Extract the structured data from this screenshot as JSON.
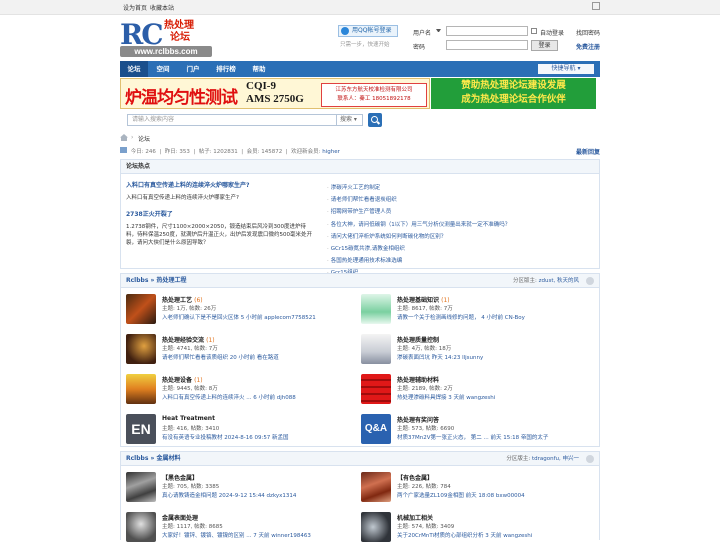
{
  "topbar": {
    "set_home": "设为首页",
    "bookmark": "收藏本站"
  },
  "logo": {
    "rc": "RC",
    "cn_line1": "热处理",
    "cn_line2": "论坛",
    "url": "www.rclbbs.com"
  },
  "login": {
    "qq_button": "用QQ帐号登录",
    "qq_sub": "只需一步，快速开始",
    "username_label": "用户名",
    "password_label": "密码",
    "auto_login": "自动登录",
    "forgot": "找回密码",
    "login_button": "登录",
    "register": "免费注册"
  },
  "nav": {
    "items": [
      "论坛",
      "空间",
      "门户",
      "排行榜",
      "帮助"
    ],
    "quick": "快捷导航"
  },
  "banner1": {
    "headline": "炉温均匀性测试",
    "model1": "CQI-9",
    "model2": "AMS 2750G",
    "company": "江苏东方航天校准检测有限公司",
    "contact": "联系人：秦工 18051892178"
  },
  "banner2": {
    "line1": "赞助热处理论坛建设发展",
    "line2": "成为热处理论坛合作伙伴"
  },
  "search": {
    "placeholder": "请输入搜索内容",
    "select": "搜索"
  },
  "breadcrumb": {
    "current": "论坛"
  },
  "stats": {
    "today_label": "今日:",
    "today": "246",
    "yesterday_label": "昨日:",
    "yesterday": "353",
    "posts_label": "帖子:",
    "posts": "1202831",
    "members_label": "会员:",
    "members": "145872",
    "newest_label": "欢迎新会员:",
    "newest": "higher",
    "latest_reply": "最新回复"
  },
  "hot": {
    "title": "论坛热点",
    "left": [
      {
        "title": "入料口有真空传递上料的连续淬火炉哪家生产?",
        "body": "入料口有真空传递上料的连续淬火炉哪家生产?"
      },
      {
        "title": "2738正火开裂了",
        "body": "1.2738钢件，尺寸1100×2000×2050，锻造结束后风冷到300度进炉待料，待料保温250度，就满炉后升温正火，出炉后发现震口微约500毫米处开裂，请问大侠们是什么原因导致？"
      }
    ],
    "right": [
      "渗碳淬火工艺的制定",
      "请老师们帮忙看看退炭组织",
      "招聘网带炉生产管理人员",
      "各位大神，请问低碳钢（1以下）用三气分析仪测量出来就一定不准确吗？",
      "请问大佬们淬析炉系统如何判断碳化物的区别？",
      "GCr15碳氮共渗,请教金相组织",
      "各国热处理通用技术标准选编",
      "Gcr15组织"
    ]
  },
  "sections": [
    {
      "cat": "Rclbbs » 热处理工程",
      "moderators_label": "分区版主:",
      "moderators": "zdust, 秋天的风",
      "forums": [
        {
          "name": "热处理工艺",
          "today": "(6)",
          "stats": "主题: 1万, 帖数: 26万",
          "last": "入老师们确认下是不是回火区体 5 小时前 applecom7758521"
        },
        {
          "name": "热处理基础知识",
          "today": "(1)",
          "stats": "主题: 8617, 帖数: 7万",
          "last": "请教一个关于检测画线修的问题， 4 小时前 CN-Boy"
        },
        {
          "name": "热处理经验交流",
          "today": "(1)",
          "stats": "主题: 4741, 帖数: 7万",
          "last": "请老师们帮忙看看该质组织 20 小时前 看在路道"
        },
        {
          "name": "热处理质量控制",
          "today": "",
          "stats": "主题: 4万, 帖数: 18万",
          "last": "渗碳表面凹坑 昨天 14:23 lljsunny"
        },
        {
          "name": "热处理设备",
          "today": "(1)",
          "stats": "主题: 9445, 帖数: 8万",
          "last": "入料口有真空传递上料的连续淬火 ... 6 小时前 djh088"
        },
        {
          "name": "热处理辅助材料",
          "today": "",
          "stats": "主题: 2189, 帖数: 2万",
          "last": "热处理渗碳料具焊接 3 天前 wangzeshi"
        },
        {
          "name": "Heat Treatment",
          "today": "",
          "stats": "主题: 416, 帖数: 3410",
          "last": "有没有英语专业投稿教材 2024-8-16 09:57 新孟国"
        },
        {
          "name": "热处理有奖问答",
          "today": "",
          "stats": "主题: 573, 帖数: 6690",
          "last": "材质37Mn2V第一张正火态， 第二 ... 前天 15:18 帝国的太子"
        }
      ]
    },
    {
      "cat": "Rclbbs » 金属材料",
      "moderators_label": "分区版主:",
      "moderators": "tdragonfu, 申兴一",
      "forums": [
        {
          "name": "【黑色金属】",
          "today": "",
          "stats": "主题: 705, 帖数: 3385",
          "last": "真心请教铸造金相问题 2024-9-12 15:44 dzkyx1314"
        },
        {
          "name": "【有色金属】",
          "today": "",
          "stats": "主题: 226, 帖数: 784",
          "last": "两个广家选量ZL109金相图 前天 18:08 bxw00004"
        },
        {
          "name": "金属表面处理",
          "today": "",
          "stats": "主题: 1117, 帖数: 8685",
          "last": "大家好！镀锌、镀铬、镀镍的区别 ... 7 天前 winner198463"
        },
        {
          "name": "机械加工相关",
          "today": "",
          "stats": "主题: 574, 帖数: 3409",
          "last": "关于20CrMnTi材质的心部组织分析 3 天前 wangzeshi"
        }
      ]
    }
  ]
}
